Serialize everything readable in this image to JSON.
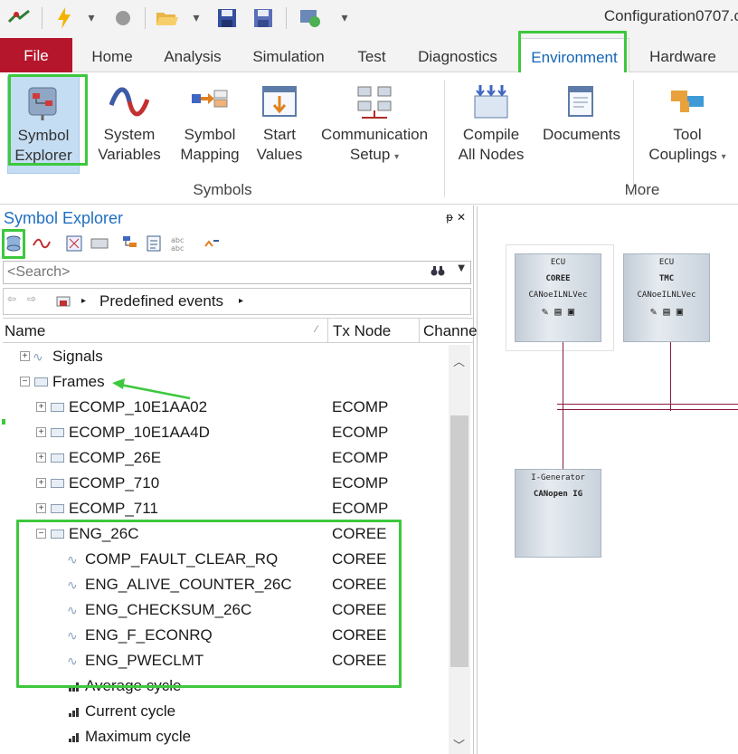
{
  "window": {
    "title": "Configuration0707.c"
  },
  "tabs": [
    {
      "label": "File"
    },
    {
      "label": "Home"
    },
    {
      "label": "Analysis"
    },
    {
      "label": "Simulation"
    },
    {
      "label": "Test"
    },
    {
      "label": "Diagnostics"
    },
    {
      "label": "Environment"
    },
    {
      "label": "Hardware"
    }
  ],
  "ribbon": {
    "symbols_group": "Symbols",
    "more_group": "More",
    "buttons": {
      "symbol_explorer": [
        "Symbol",
        "Explorer"
      ],
      "system_variables": [
        "System",
        "Variables"
      ],
      "symbol_mapping": [
        "Symbol",
        "Mapping"
      ],
      "start_values": [
        "Start",
        "Values"
      ],
      "communication_setup": [
        "Communication",
        "Setup"
      ],
      "compile_all_nodes": [
        "Compile",
        "All Nodes"
      ],
      "documents": [
        "Documents"
      ],
      "tool_couplings": [
        "Tool",
        "Couplings"
      ]
    }
  },
  "panel": {
    "title": "Symbol Explorer",
    "pin": "ᵽ ✕",
    "search_placeholder": "<Search>",
    "nav_path": "Predefined events",
    "columns": [
      "Name",
      "Tx Node",
      "Channe"
    ]
  },
  "tree": [
    {
      "name": "Signals",
      "tx": "",
      "type": "signals"
    },
    {
      "name": "Frames",
      "tx": "",
      "type": "frames"
    },
    {
      "name": "ECOMP_10E1AA02",
      "tx": "ECOMP",
      "type": "frame"
    },
    {
      "name": "ECOMP_10E1AA4D",
      "tx": "ECOMP",
      "type": "frame"
    },
    {
      "name": "ECOMP_26E",
      "tx": "ECOMP",
      "type": "frame"
    },
    {
      "name": "ECOMP_710",
      "tx": "ECOMP",
      "type": "frame"
    },
    {
      "name": "ECOMP_711",
      "tx": "ECOMP",
      "type": "frame"
    },
    {
      "name": "ENG_26C",
      "tx": "COREE",
      "type": "frame-open"
    },
    {
      "name": "COMP_FAULT_CLEAR_RQ",
      "tx": "COREE",
      "type": "signal"
    },
    {
      "name": "ENG_ALIVE_COUNTER_26C",
      "tx": "COREE",
      "type": "signal"
    },
    {
      "name": "ENG_CHECKSUM_26C",
      "tx": "COREE",
      "type": "signal"
    },
    {
      "name": "ENG_F_ECONRQ",
      "tx": "COREE",
      "type": "signal"
    },
    {
      "name": "ENG_PWECLMT",
      "tx": "COREE",
      "type": "signal"
    },
    {
      "name": "Average cycle",
      "tx": "",
      "type": "stat"
    },
    {
      "name": "Current cycle",
      "tx": "",
      "type": "stat"
    },
    {
      "name": "Maximum cycle",
      "tx": "",
      "type": "stat"
    }
  ],
  "canvas": {
    "nodes": [
      {
        "kind": "ECU",
        "name": "COREE",
        "bus": "CANoeILNLVec"
      },
      {
        "kind": "ECU",
        "name": "TMC",
        "bus": "CANoeILNLVec"
      },
      {
        "kind": "I-Generator",
        "name": "CANopen IG",
        "bus": ""
      }
    ]
  },
  "colors": {
    "accent": "#1f6fc1",
    "file_tab": "#b5162b",
    "highlight": "#3dc83d",
    "bus_wire": "#8a1a3a"
  }
}
